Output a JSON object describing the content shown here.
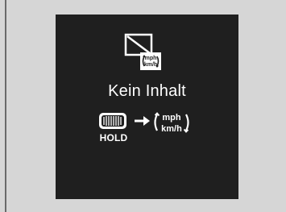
{
  "display": {
    "message": "Kein Inhalt",
    "hold_label": "HOLD",
    "unit_top": "mph",
    "unit_bottom": "km/h"
  },
  "icons": {
    "no_content": "no-content-screen-icon",
    "unit_toggle_small": "unit-toggle-icon",
    "hold_button": "hold-button-icon",
    "arrow": "arrow-right-icon",
    "unit_toggle_large": "unit-toggle-icon"
  },
  "colors": {
    "background": "#d6d6d6",
    "display": "#1f1f1f",
    "text": "#ffffff"
  }
}
